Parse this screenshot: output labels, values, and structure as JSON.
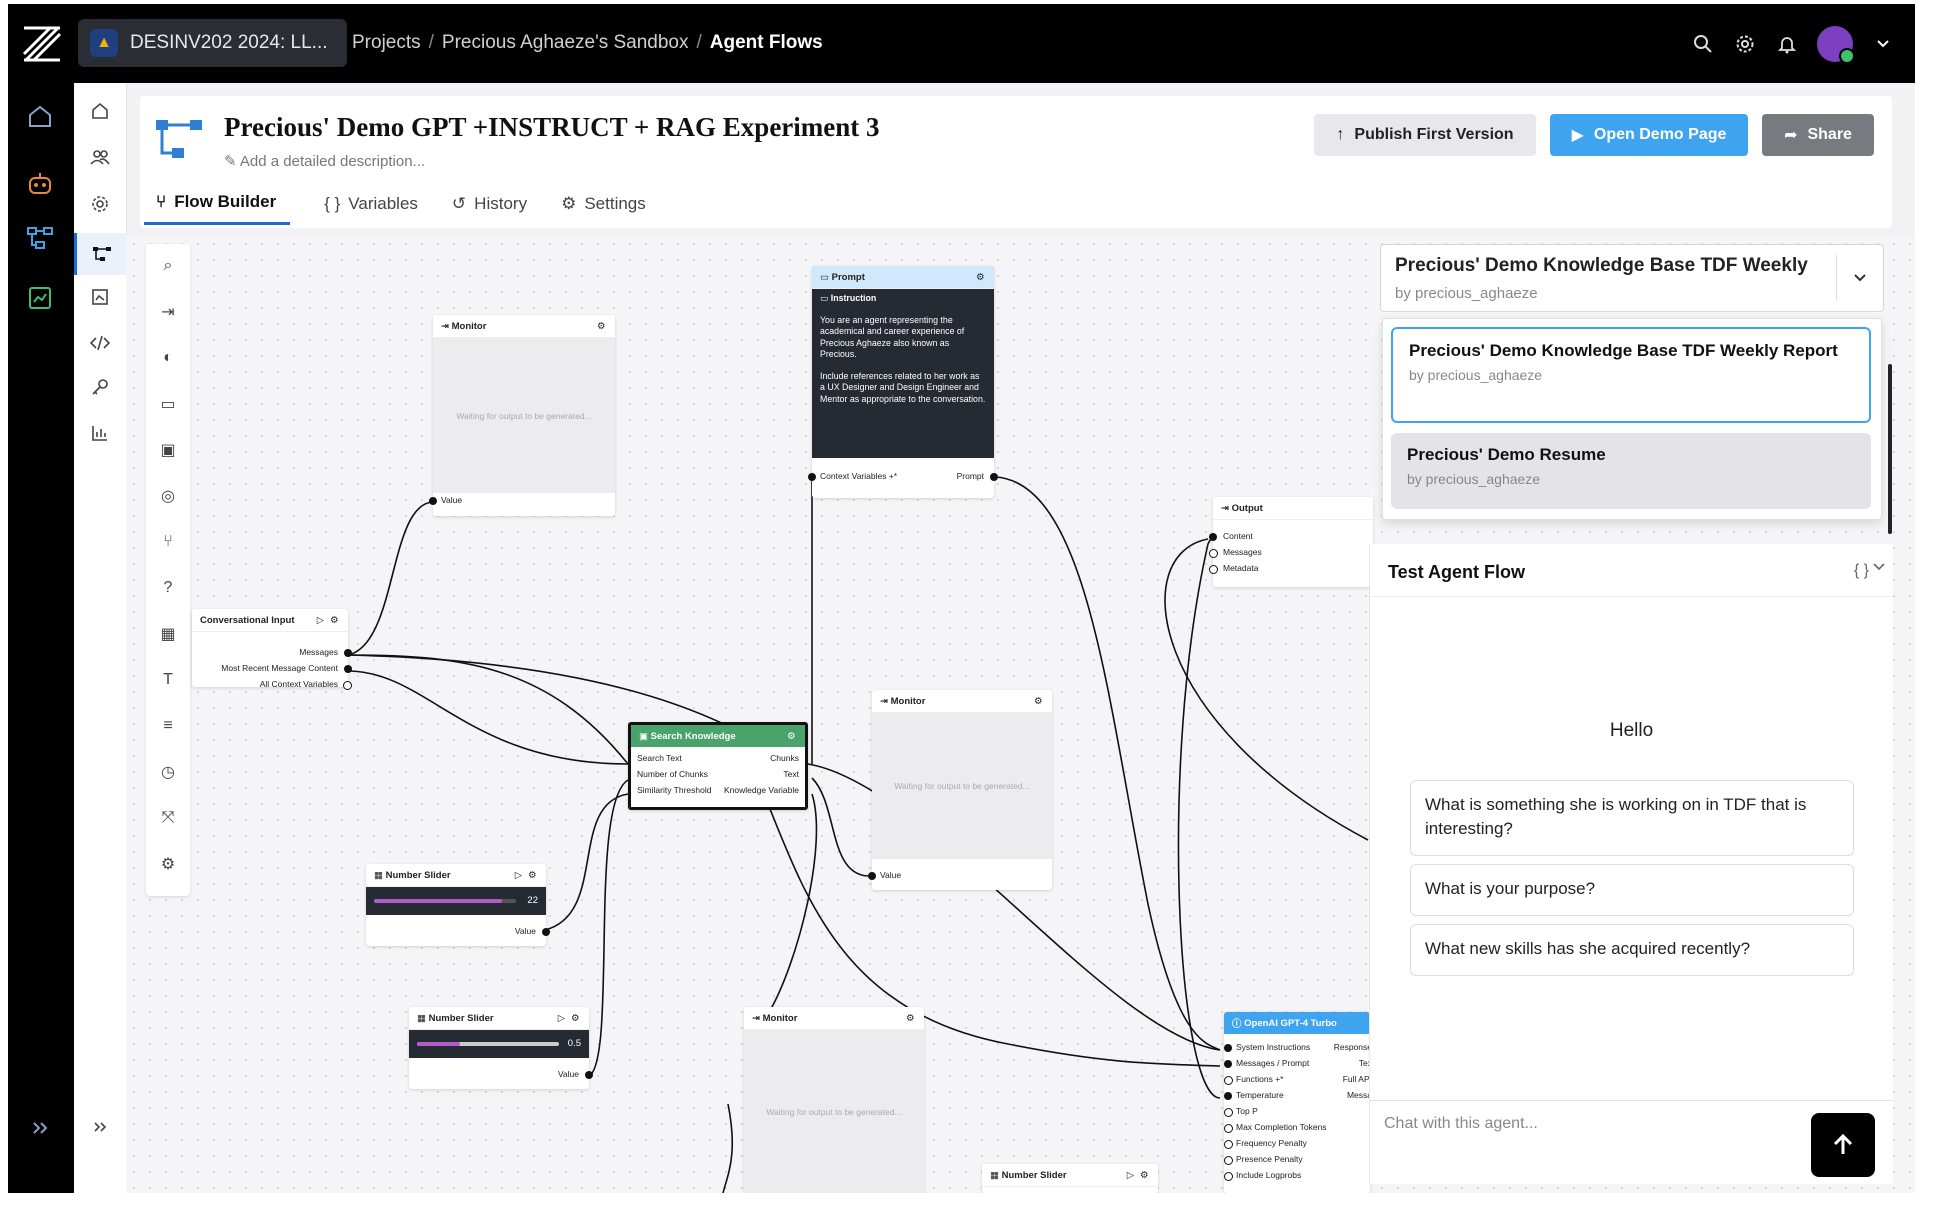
{
  "topbar": {
    "org_name": "DESINV202 2024: LL...",
    "breadcrumb": [
      "Projects",
      "Precious Aghaeze's Sandbox",
      "Agent Flows"
    ]
  },
  "header": {
    "title": "Precious' Demo GPT +INSTRUCT + RAG Experiment 3",
    "description_placeholder": "Add a detailed description...",
    "buttons": {
      "publish": "Publish First Version",
      "demo": "Open Demo Page",
      "share": "Share"
    },
    "tabs": [
      "Flow Builder",
      "Variables",
      "History",
      "Settings"
    ]
  },
  "nodes": {
    "monitor_placeholder": "Waiting for output to be generated...",
    "monitor_title": "Monitor",
    "monitor_port": "Value",
    "prompt": {
      "header": "Prompt",
      "section": "Instruction",
      "text1": "You are an agent representing the academical and career experience of Precious Aghaeze also known as Precious.",
      "text2": "Include references related to her work as a UX Designer and Design Engineer and Mentor as appropriate to the conversation.",
      "port_in": "Context Variables +*",
      "port_out": "Prompt"
    },
    "conversational": {
      "title": "Conversational Input",
      "ports": [
        "Messages",
        "Most Recent Message Content",
        "All Context Variables"
      ]
    },
    "search": {
      "title": "Search Knowledge",
      "left_ports": [
        "Search Text",
        "Number of Chunks",
        "Similarity Threshold"
      ],
      "right_ports": [
        "Chunks",
        "Text",
        "Knowledge Variable"
      ]
    },
    "slider1": {
      "title": "Number Slider",
      "value": "22",
      "port": "Value",
      "level": 0.9
    },
    "slider2": {
      "title": "Number Slider",
      "value": "0.5",
      "port": "Value",
      "level": 0.3
    },
    "slider3": {
      "title": "Number Slider"
    },
    "output": {
      "title": "Output",
      "ports": [
        "Content",
        "Messages",
        "Metadata"
      ]
    },
    "openai": {
      "title": "OpenAI GPT-4 Turbo",
      "left_ports": [
        "System Instructions",
        "Messages / Prompt",
        "Functions +*",
        "Temperature",
        "Top P",
        "Max Completion Tokens",
        "Frequency Penalty",
        "Presence Penalty",
        "Include Logprobs"
      ],
      "right_ports": [
        "Response",
        "Tex",
        "Full API",
        "Messa"
      ]
    }
  },
  "knowledge": {
    "selected_title": "Precious' Demo Knowledge Base TDF Weekly",
    "selected_by": "by precious_aghaeze",
    "options": [
      {
        "title": "Precious' Demo Knowledge Base TDF Weekly Report",
        "by": "by precious_aghaeze"
      },
      {
        "title": "Precious' Demo Resume",
        "by": "by precious_aghaeze"
      }
    ]
  },
  "chat": {
    "header": "Test Agent Flow",
    "greeting": "Hello",
    "suggestions": [
      "What is something she is working on in TDF that is interesting?",
      "What is your purpose?",
      "What new skills has she acquired recently?"
    ],
    "input_placeholder": "Chat with this agent..."
  }
}
